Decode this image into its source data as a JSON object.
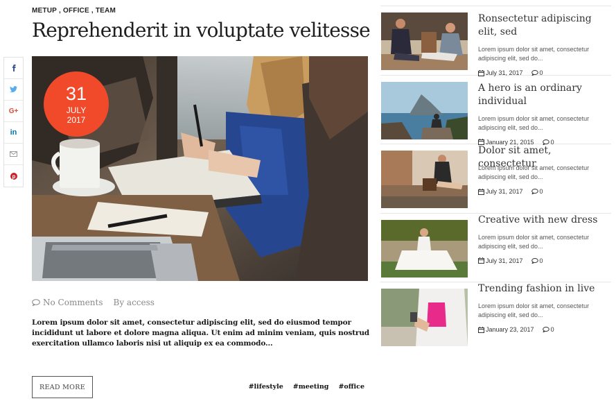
{
  "article": {
    "categories": [
      "METUP",
      "OFFICE",
      "TEAM"
    ],
    "category_separator": ",",
    "title": "Reprehenderit in voluptate velitesse",
    "date": {
      "day": "31",
      "month": "JULY",
      "year": "2017"
    },
    "comments": "No Comments",
    "author": "By access",
    "excerpt": "Lorem ipsum dolor sit amet, consectetur adipiscing elit, sed do eiusmod tempor incididunt ut labore et dolore magna aliqua. Ut enim ad minim veniam, quis nostrud exercitation ullamco laboris nisi ut aliquip ex ea commodo...",
    "read_more": "READ MORE",
    "tags": [
      "#lifestyle",
      "#meeting",
      "#office"
    ]
  },
  "share": {
    "icons": [
      "facebook-icon",
      "twitter-icon",
      "google-plus-icon",
      "linkedin-icon",
      "email-icon",
      "pinterest-icon"
    ],
    "colors": {
      "facebook": "#3b5998",
      "twitter": "#55acee",
      "google": "#dd4b39",
      "linkedin": "#0077b5",
      "email": "#999999",
      "pinterest": "#cb2027"
    }
  },
  "accent_color": "#f14a2b",
  "sidebar": {
    "posts": [
      {
        "title": "Ronsectetur adipiscing elit, sed",
        "excerpt": "Lorem ipsum dolor sit amet, consectetur adipiscing elit, sed do...",
        "date": "July 31, 2017",
        "comments": "0"
      },
      {
        "title": "A hero is an ordinary individual",
        "excerpt": "Lorem ipsum dolor sit amet, consectetur adipiscing elit, sed do...",
        "date": "January 21, 2015",
        "comments": "0"
      },
      {
        "title": "Dolor sit amet, consectetur",
        "excerpt": "Lorem ipsum dolor sit amet, consectetur adipiscing elit, sed do...",
        "date": "July 31, 2017",
        "comments": "0"
      },
      {
        "title": "Creative with new dress",
        "excerpt": "Lorem ipsum dolor sit amet, consectetur adipiscing elit, sed do...",
        "date": "July 31, 2017",
        "comments": "0"
      },
      {
        "title": "Trending fashion in live",
        "excerpt": "Lorem ipsum dolor sit amet, consectetur adipiscing elit, sed do...",
        "date": "January 23, 2017",
        "comments": "0"
      }
    ]
  }
}
